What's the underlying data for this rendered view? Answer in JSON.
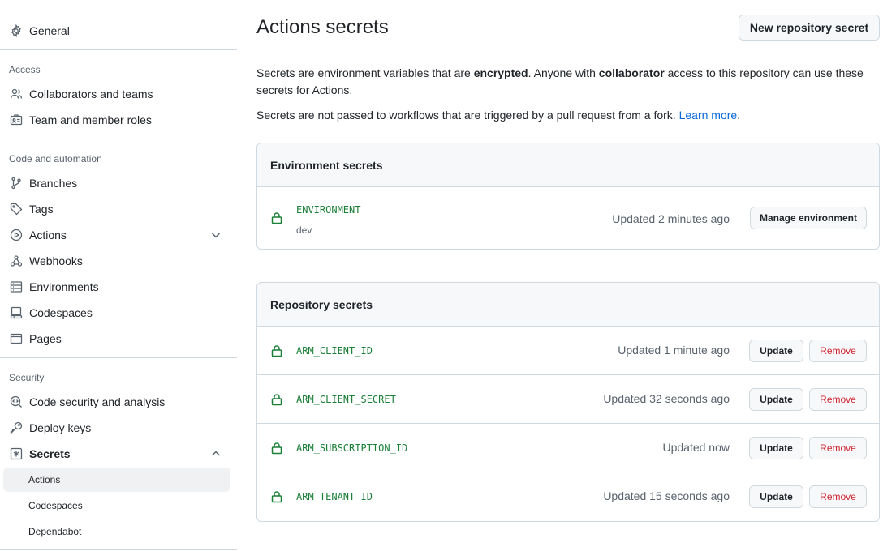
{
  "sidebar": {
    "general": "General",
    "access_heading": "Access",
    "collaborators": "Collaborators and teams",
    "team_roles": "Team and member roles",
    "code_heading": "Code and automation",
    "branches": "Branches",
    "tags": "Tags",
    "actions": "Actions",
    "webhooks": "Webhooks",
    "environments": "Environments",
    "codespaces": "Codespaces",
    "pages": "Pages",
    "security_heading": "Security",
    "code_security": "Code security and analysis",
    "deploy_keys": "Deploy keys",
    "secrets": "Secrets",
    "sub_actions": "Actions",
    "sub_codespaces": "Codespaces",
    "sub_dependabot": "Dependabot"
  },
  "main": {
    "title": "Actions secrets",
    "new_button": "New repository secret",
    "desc1_a": "Secrets are environment variables that are ",
    "desc1_b": "encrypted",
    "desc1_c": ". Anyone with ",
    "desc1_d": "collaborator",
    "desc1_e": " access to this repository can use these secrets for Actions.",
    "desc2_a": "Secrets are not passed to workflows that are triggered by a pull request from a fork. ",
    "desc2_link": "Learn more",
    "desc2_end": "."
  },
  "environment_secrets": {
    "heading": "Environment secrets",
    "items": [
      {
        "name": "ENVIRONMENT",
        "env": "dev",
        "updated": "Updated 2 minutes ago",
        "button": "Manage environment"
      }
    ]
  },
  "repository_secrets": {
    "heading": "Repository secrets",
    "update_label": "Update",
    "remove_label": "Remove",
    "items": [
      {
        "name": "ARM_CLIENT_ID",
        "updated": "Updated 1 minute ago"
      },
      {
        "name": "ARM_CLIENT_SECRET",
        "updated": "Updated 32 seconds ago"
      },
      {
        "name": "ARM_SUBSCRIPTION_ID",
        "updated": "Updated now"
      },
      {
        "name": "ARM_TENANT_ID",
        "updated": "Updated 15 seconds ago"
      }
    ]
  },
  "colors": {
    "secret_green": "#1a7f37",
    "link_blue": "#0969da",
    "danger_red": "#d1242f"
  }
}
